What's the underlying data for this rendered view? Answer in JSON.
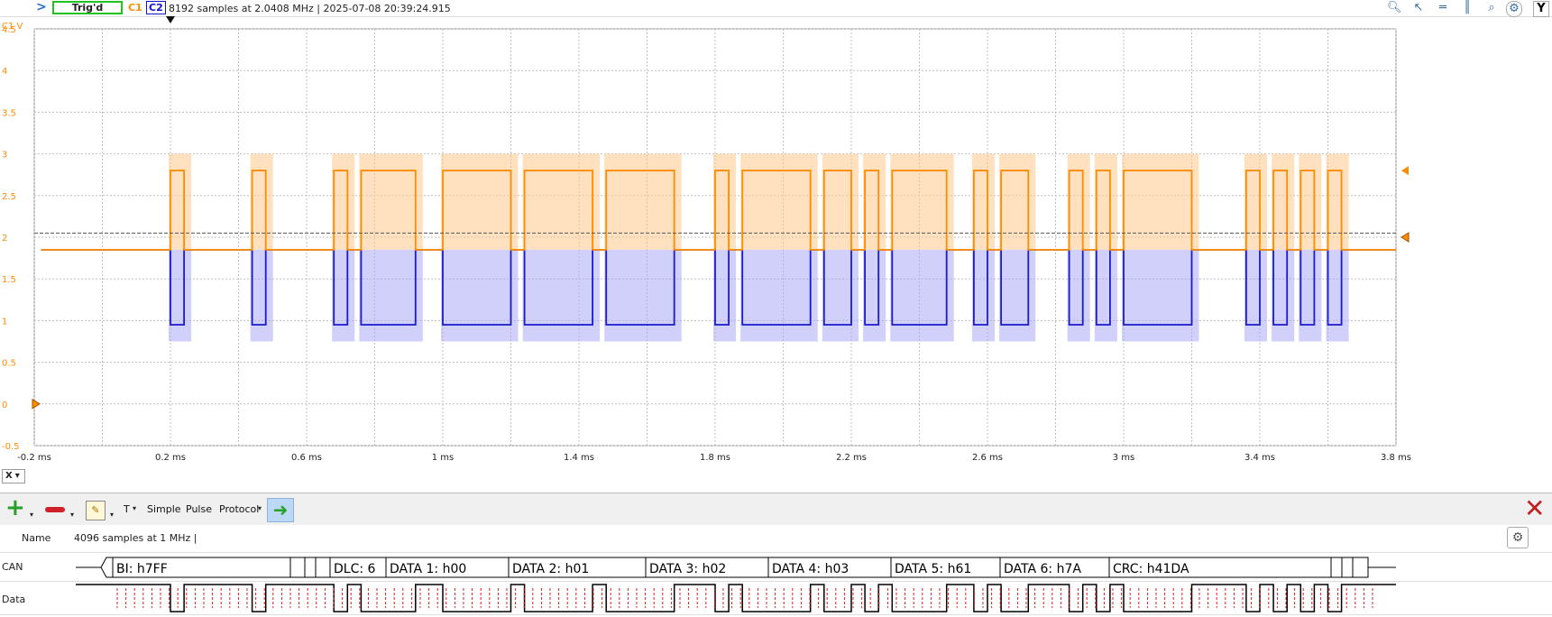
{
  "header": {
    "expand_glyph": ">",
    "trigger_status": "Trig'd",
    "ch1_label": "C1",
    "ch2_label": "C2",
    "capture_info": "8192 samples at 2.0408 MHz | 2025-07-08 20:39:24.915",
    "tool_icons": [
      "zoom-icon",
      "cursor-icon",
      "cursor-horizontal-icon",
      "cursor-vertical-icon",
      "search-icon",
      "settings-icon"
    ],
    "y_button": "Y"
  },
  "plot": {
    "y_unit_label": "C1 V",
    "y_ticks": [
      "4.5",
      "4",
      "3.5",
      "3",
      "2.5",
      "2",
      "1.5",
      "1",
      "0.5",
      "0",
      "-0.5"
    ],
    "x_ticks": [
      "-0.2 ms",
      "0.2 ms",
      "0.6 ms",
      "1 ms",
      "1.4 ms",
      "1.8 ms",
      "2.2 ms",
      "2.6 ms",
      "3 ms",
      "3.4 ms",
      "3.8 ms"
    ],
    "x_button": "X",
    "colors": {
      "ch1": "#ff8c00",
      "ch2": "#1a1ad0",
      "ch1_fill": "#ffc98a",
      "ch2_fill": "#a9a9f5",
      "grid": "#bfbfbf"
    }
  },
  "chart_data": {
    "type": "line",
    "xlabel": "",
    "ylabel": "C1 V",
    "xlim": [
      -0.2,
      3.8
    ],
    "ylim": [
      -0.5,
      4.5
    ],
    "grid": true,
    "series": [
      {
        "name": "C1",
        "high": 2.8,
        "low": 1.85,
        "high_intervals_ms": [
          [
            0.2,
            0.24
          ],
          [
            0.44,
            0.48
          ],
          [
            0.68,
            0.72
          ],
          [
            0.76,
            0.92
          ],
          [
            1.0,
            1.2
          ],
          [
            1.24,
            1.44
          ],
          [
            1.48,
            1.68
          ],
          [
            1.8,
            1.84
          ],
          [
            1.88,
            2.08
          ],
          [
            2.12,
            2.2
          ],
          [
            2.24,
            2.28
          ],
          [
            2.32,
            2.48
          ],
          [
            2.56,
            2.6
          ],
          [
            2.64,
            2.72
          ],
          [
            2.84,
            2.88
          ],
          [
            2.92,
            2.96
          ],
          [
            3.0,
            3.2
          ],
          [
            3.36,
            3.4
          ],
          [
            3.44,
            3.48
          ],
          [
            3.52,
            3.56
          ],
          [
            3.6,
            3.64
          ]
        ]
      },
      {
        "name": "C2",
        "high": 1.85,
        "low": 0.95,
        "low_intervals_ms": [
          [
            0.2,
            0.24
          ],
          [
            0.44,
            0.48
          ],
          [
            0.68,
            0.72
          ],
          [
            0.76,
            0.92
          ],
          [
            1.0,
            1.2
          ],
          [
            1.24,
            1.44
          ],
          [
            1.48,
            1.68
          ],
          [
            1.8,
            1.84
          ],
          [
            1.88,
            2.08
          ],
          [
            2.12,
            2.2
          ],
          [
            2.24,
            2.28
          ],
          [
            2.32,
            2.48
          ],
          [
            2.56,
            2.6
          ],
          [
            2.64,
            2.72
          ],
          [
            2.84,
            2.88
          ],
          [
            2.92,
            2.96
          ],
          [
            3.0,
            3.2
          ],
          [
            3.36,
            3.4
          ],
          [
            3.44,
            3.48
          ],
          [
            3.52,
            3.56
          ],
          [
            3.6,
            3.64
          ]
        ]
      }
    ]
  },
  "protocol_toolbar": {
    "add_icon": "plus-icon",
    "remove_icon": "minus-icon",
    "edit_icon": "pencil-icon",
    "t_menu": "T",
    "simple": "Simple",
    "pulse": "Pulse",
    "protocol": "Protocol",
    "apply_icon": "arrow-right-icon",
    "close_icon": "close-icon"
  },
  "decoder": {
    "name_header": "Name",
    "samples_info": "4096 samples at 1 MHz |",
    "row_can": "CAN",
    "row_data": "Data",
    "can_fields": [
      {
        "label": "BI: h7FF"
      },
      {
        "label": ""
      },
      {
        "label": ""
      },
      {
        "label": ""
      },
      {
        "label": "DLC: 6"
      },
      {
        "label": "DATA 1: h00"
      },
      {
        "label": "DATA 2: h01"
      },
      {
        "label": "DATA 3: h02"
      },
      {
        "label": "DATA 4: h03"
      },
      {
        "label": "DATA 5: h61"
      },
      {
        "label": "DATA 6: h7A"
      },
      {
        "label": "CRC: h41DA"
      },
      {
        "label": ""
      },
      {
        "label": ""
      },
      {
        "label": ""
      }
    ]
  }
}
